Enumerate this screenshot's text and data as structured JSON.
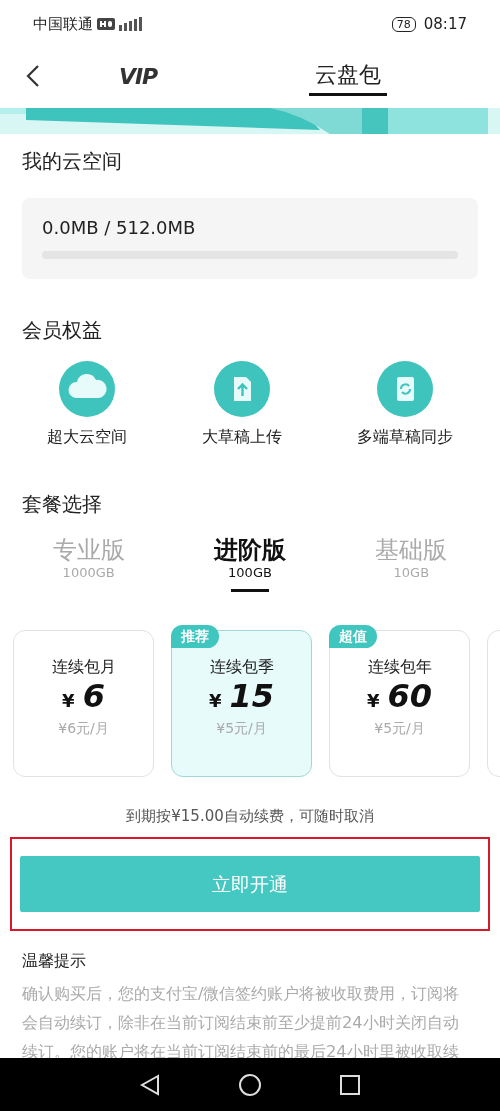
{
  "status_bar": {
    "carrier": "中国联通",
    "battery": "78",
    "time": "08:17"
  },
  "nav": {
    "tabs": [
      {
        "label": "VIP",
        "kind": "logo",
        "selected": false
      },
      {
        "label": "云盘包",
        "kind": "text",
        "selected": true
      }
    ]
  },
  "storage": {
    "title": "我的云空间",
    "usage": "0.0MB / 512.0MB",
    "level": 0
  },
  "benefits": {
    "title": "会员权益",
    "items": [
      {
        "label": "超大云空间",
        "kind": "cloud"
      },
      {
        "label": "大草稿上传",
        "kind": "upload"
      },
      {
        "label": "多端草稿同步",
        "kind": "sync"
      }
    ]
  },
  "packages": {
    "title": "套餐选择",
    "tiers": [
      {
        "name": "专业版",
        "size": "1000GB",
        "selected": false
      },
      {
        "name": "进阶版",
        "size": "100GB",
        "selected": true
      },
      {
        "name": "基础版",
        "size": "10GB",
        "selected": false
      }
    ]
  },
  "plans": [
    {
      "name": "连续包月",
      "currency": "¥",
      "price": "6",
      "monthly": "¥6元/月",
      "selected": false
    },
    {
      "name": "连续包季",
      "currency": "¥",
      "price": "15",
      "monthly": "¥5元/月",
      "badge": "推荐",
      "selected": true
    },
    {
      "name": "连续包年",
      "currency": "¥",
      "price": "60",
      "monthly": "¥5元/月",
      "badge": "超值",
      "selected": false
    }
  ],
  "renewal_note": "到期按¥15.00自动续费，可随时取消",
  "subscribe_button": "立即开通",
  "tips": {
    "title": "温馨提示",
    "lines": [
      "确认购买后，您的支付宝/微信签约账户将被收取费用，订阅将",
      "会自动续订，除非在当前订阅结束前至少提前24小时关闭自动",
      "续订。您的账户将在当前订阅结束前的最后24小时里被收取续"
    ]
  }
}
